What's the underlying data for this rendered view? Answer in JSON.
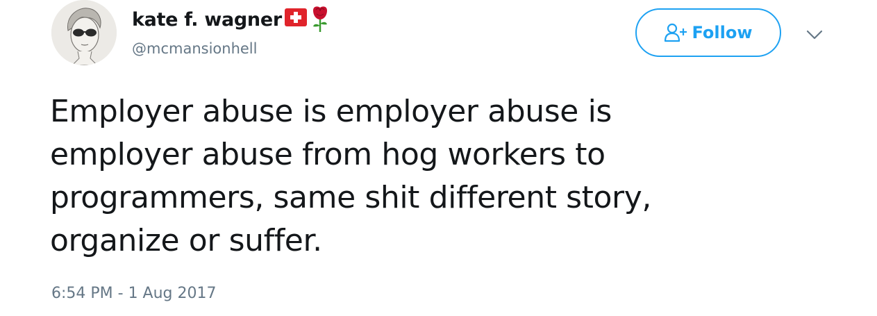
{
  "user": {
    "display_name": "kate f. wagner",
    "handle": "@mcmansionhell",
    "avatar_icon": "sketch-portrait-avatar",
    "name_emoji": [
      "swiss-flag-icon",
      "rose-icon"
    ]
  },
  "actions": {
    "follow_label": "Follow",
    "follow_icon": "add-user-icon",
    "menu_icon": "chevron-down-icon"
  },
  "tweet": {
    "text_lines": [
      "Employer abuse is employer abuse is",
      "employer abuse from hog workers to",
      "programmers, same shit different story,",
      "organize or suffer."
    ],
    "timestamp": "6:54 PM - 1 Aug 2017"
  },
  "colors": {
    "brand_blue": "#1da1f2",
    "text_primary": "#14171a",
    "text_secondary": "#657786",
    "flag_red": "#e0242b",
    "rose_red": "#c8102e",
    "stem_green": "#3a9a2f"
  }
}
